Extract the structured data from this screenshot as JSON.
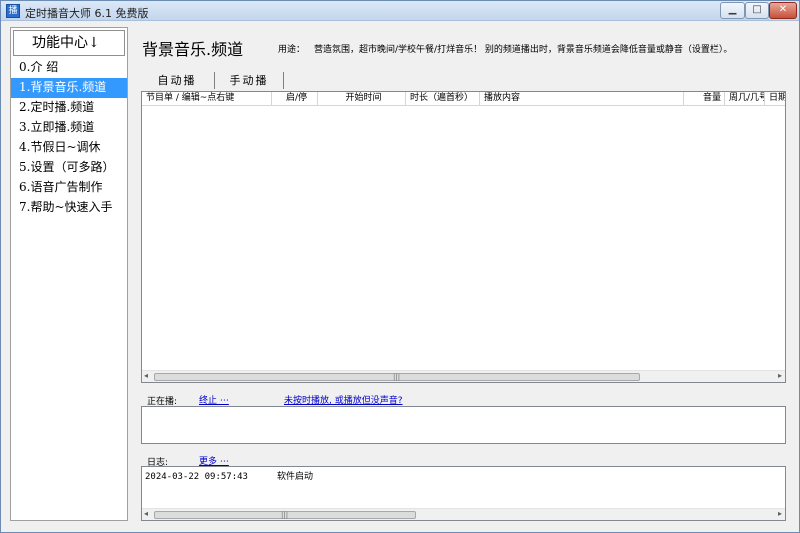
{
  "window": {
    "title": "定时播音大师 6.1 免费版",
    "icon_text": "播",
    "min_label": "▁",
    "max_label": "□",
    "close_label": "✕"
  },
  "sidebar": {
    "header": "功能中心↓",
    "items": [
      {
        "label": "0.介 绍"
      },
      {
        "label": "1.背景音乐.频道",
        "active": true
      },
      {
        "label": "2.定时播.频道"
      },
      {
        "label": "3.立即播.频道"
      },
      {
        "label": "4.节假日~调休"
      },
      {
        "label": "5.设置（可多路）"
      },
      {
        "label": "6.语音广告制作"
      },
      {
        "label": "7.帮助~快速入手"
      }
    ]
  },
  "main": {
    "title": "背景音乐.频道",
    "usage_label": "用途：",
    "usage_text": "营造氛围，超市晚间/学校午餐/打烊音乐！  别的频道播出时，背景音乐频道会降低音量或静音（设置栏）。",
    "tabs": [
      {
        "label": "自动播",
        "selected": true
      },
      {
        "label": "手动播",
        "selected": false
      }
    ]
  },
  "table": {
    "columns": [
      "节目单  / 编辑~点右键",
      "启/停",
      "开始时间",
      "时长（遍首秒）",
      "播放内容",
      "音量",
      "周几/几号",
      "日期"
    ],
    "rows": []
  },
  "now_playing": {
    "label": "正在播:",
    "stop_link": "终止 ⋯",
    "help_link": "未按时播放, 或播放但没声音?"
  },
  "log": {
    "label": "日志:",
    "more_link": "更多 ⋯",
    "entries": [
      {
        "time": "2024-03-22 09:57:43",
        "message": "软件启动"
      }
    ]
  },
  "scrollbar": {
    "left_arrow": "◂",
    "right_arrow": "▸",
    "grip": "|||"
  }
}
